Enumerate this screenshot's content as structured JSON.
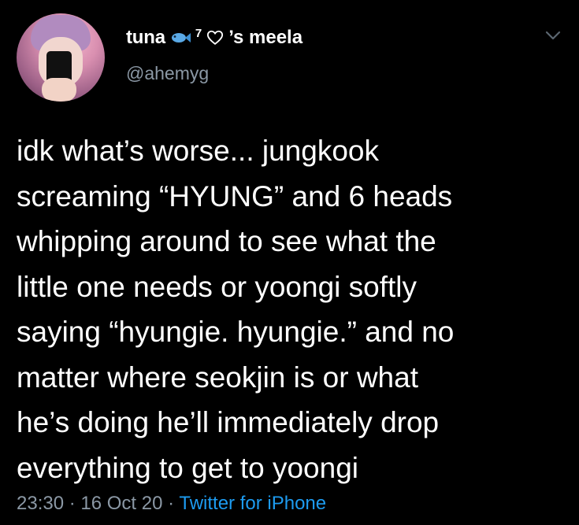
{
  "colors": {
    "background": "#000000",
    "text": "#ffffff",
    "secondary_text": "#8b98a5",
    "link": "#1d9bf0"
  },
  "author": {
    "display_name": "tuna",
    "name_emoji_icon": "fish-icon",
    "superscript": "7",
    "heart_icon": "heart-outline-icon",
    "name_suffix": "’s meela",
    "handle": "@ahemyg"
  },
  "tweet": {
    "lines": [
      "idk what’s worse... jungkook",
      "screaming “HYUNG” and 6 heads",
      "whipping around to see what the",
      "little one needs or yoongi softly",
      "saying “hyungie. hyungie.” and no",
      "matter where seokjin is or what",
      "he’s doing he’ll immediately drop",
      "everything to get to yoongi"
    ]
  },
  "meta": {
    "time": "23:30",
    "separator": " · ",
    "date": "16 Oct 20",
    "source": "Twitter for iPhone"
  }
}
